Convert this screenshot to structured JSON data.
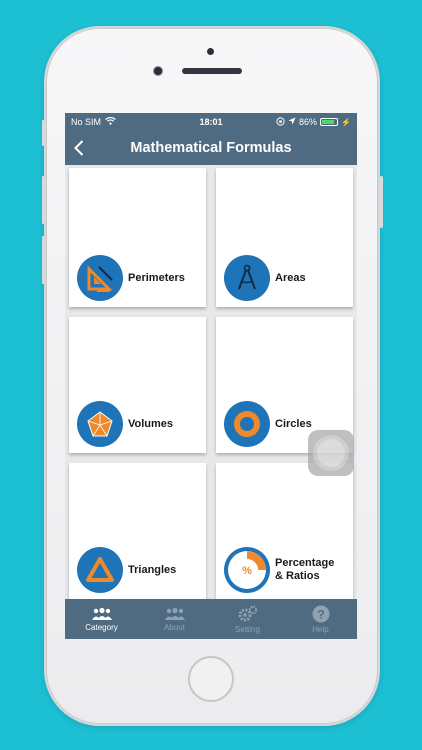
{
  "status_bar": {
    "carrier": "No SIM",
    "time": "18:01",
    "battery": "86%",
    "battery_level": 0.86
  },
  "nav": {
    "back_icon": "chevron-left-icon",
    "title": "Mathematical Formulas"
  },
  "categories": [
    {
      "label": "Perimeters",
      "icon": "set-square-icon"
    },
    {
      "label": "Areas",
      "icon": "compass-icon"
    },
    {
      "label": "Volumes",
      "icon": "polyhedron-icon"
    },
    {
      "label": "Circles",
      "icon": "circle-icon"
    },
    {
      "label": "Triangles",
      "icon": "triangle-icon"
    },
    {
      "label": "Percentage\n& Ratios",
      "icon": "percentage-icon"
    }
  ],
  "tabs": [
    {
      "label": "Category",
      "icon": "group-icon",
      "active": true
    },
    {
      "label": "About",
      "icon": "people-icon",
      "active": false
    },
    {
      "label": "Setting",
      "icon": "gears-icon",
      "active": false
    },
    {
      "label": "Help",
      "icon": "help-icon",
      "active": false
    }
  ],
  "colors": {
    "background": "#1dbfd3",
    "bar": "#4f6b82",
    "icon_blue": "#1f73b7",
    "icon_orange": "#ee8a2c"
  }
}
